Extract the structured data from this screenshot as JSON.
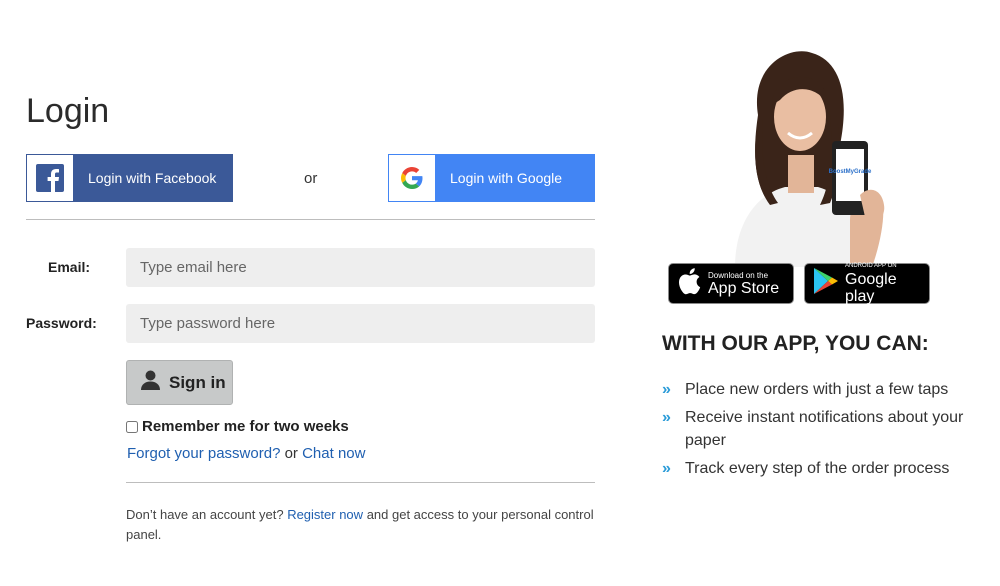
{
  "login": {
    "title": "Login",
    "facebook_label": "Login with Facebook",
    "or_text": "or",
    "google_label": "Login with Google",
    "email_label": "Email:",
    "email_placeholder": "Type email here",
    "email_value": "",
    "password_label": "Password:",
    "password_placeholder": "Type password here",
    "password_value": "",
    "signin_label": "Sign in",
    "remember_label": "Remember me for two weeks",
    "remember_checked": false,
    "forgot_link": "Forgot your password?",
    "links_or": "or",
    "chat_link": "Chat now",
    "register_prefix": "Don’t have an account yet?",
    "register_link": "Register now",
    "register_suffix": "and get access to your personal control panel."
  },
  "app_promo": {
    "app_store": {
      "small": "Download on the",
      "big": "App Store"
    },
    "google_play": {
      "small": "ANDROID APP ON",
      "big": "Google play"
    },
    "heading": "WITH OUR APP, YOU CAN:",
    "features": [
      "Place new orders with just a few taps",
      "Receive instant notifications about your paper",
      "Track every step of the order process"
    ],
    "phone_screen_text": "BoostMyGrade"
  },
  "colors": {
    "facebook": "#3b5998",
    "google": "#4285f4",
    "link": "#1f5fb0",
    "bullet": "#2a9bd8",
    "input_bg": "#eeeeee",
    "signin_bg": "#c7c9c9"
  },
  "icons": {
    "facebook": "facebook-f-icon",
    "google": "google-g-icon",
    "signin": "user-icon",
    "apple": "apple-icon",
    "play": "google-play-icon",
    "bullet": "chevron-double-right-icon"
  }
}
